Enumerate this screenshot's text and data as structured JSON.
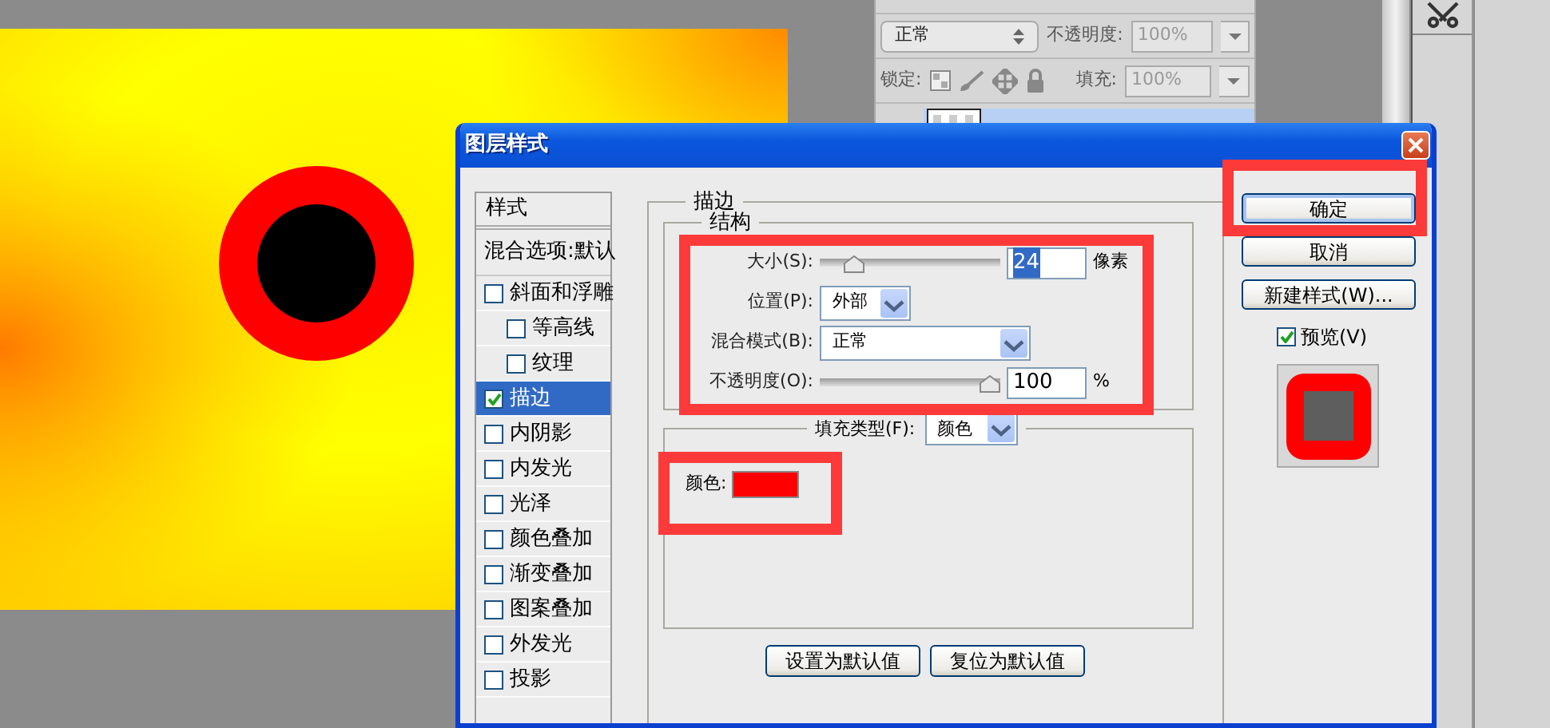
{
  "layers_panel": {
    "blend_mode": "正常",
    "opacity_label": "不透明度:",
    "opacity": "100%",
    "lock_label": "锁定:",
    "fill_label": "填充:",
    "fill": "100%"
  },
  "dialog": {
    "title": "图层样式",
    "styles_header": "样式",
    "blend_options": "混合选项:默认",
    "effects": [
      {
        "label": "斜面和浮雕",
        "checked": false,
        "selected": false,
        "children": [
          {
            "label": "等高线",
            "checked": false,
            "selected": false
          },
          {
            "label": "纹理",
            "checked": false,
            "selected": false
          }
        ]
      },
      {
        "label": "描边",
        "checked": true,
        "selected": true
      },
      {
        "label": "内阴影",
        "checked": false,
        "selected": false
      },
      {
        "label": "内发光",
        "checked": false,
        "selected": false
      },
      {
        "label": "光泽",
        "checked": false,
        "selected": false
      },
      {
        "label": "颜色叠加",
        "checked": false,
        "selected": false
      },
      {
        "label": "渐变叠加",
        "checked": false,
        "selected": false
      },
      {
        "label": "图案叠加",
        "checked": false,
        "selected": false
      },
      {
        "label": "外发光",
        "checked": false,
        "selected": false
      },
      {
        "label": "投影",
        "checked": false,
        "selected": false
      }
    ],
    "section_title": "描边",
    "structure": {
      "title": "结构",
      "rows": [
        {
          "kind": "slider",
          "label": "大小(S):",
          "level": 0.15,
          "value": "24",
          "unit": "像素"
        },
        {
          "kind": "select",
          "label": "位置(P):",
          "value": "外部"
        },
        {
          "kind": "select",
          "label": "混合模式(B):",
          "value": "正常"
        },
        {
          "kind": "slider",
          "label": "不透明度(O):",
          "level": 1,
          "value": "100",
          "unit": "%"
        }
      ]
    },
    "fill": {
      "label": "填充类型(F):",
      "value": "颜色",
      "color_label": "颜色:",
      "color": "#ff0000"
    },
    "footer_buttons": [
      "设置为默认值",
      "复位为默认值"
    ],
    "side_buttons": [
      {
        "label": "确定",
        "selected": true
      },
      {
        "label": "取消",
        "selected": false
      },
      {
        "label": "新建样式(W)...",
        "selected": false
      }
    ],
    "preview": {
      "label": "预览(V)",
      "checked": true
    }
  }
}
